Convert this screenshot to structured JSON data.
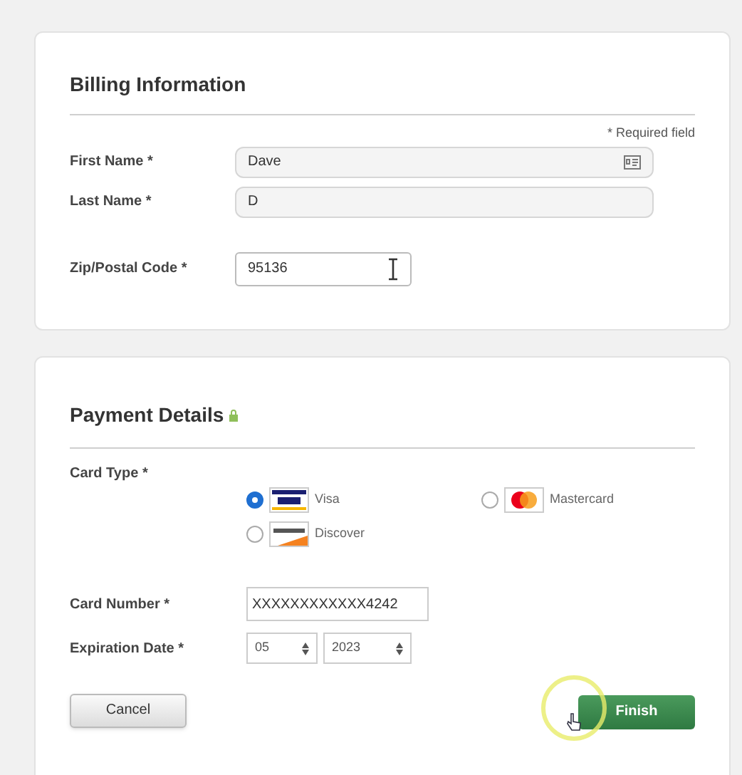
{
  "billing": {
    "title": "Billing Information",
    "required_note": "* Required field",
    "fields": [
      {
        "label": "First Name *",
        "value": "Dave",
        "kind": "wide",
        "contact_icon": true
      },
      {
        "label": "Last Name *",
        "value": "D",
        "kind": "wide",
        "contact_icon": false
      },
      {
        "label": "Zip/Postal Code *",
        "value": "95136",
        "kind": "short",
        "contact_icon": false
      }
    ]
  },
  "payment": {
    "title": "Payment Details",
    "card_type_label": "Card Type *",
    "card_types": [
      {
        "label": "Visa",
        "kind": "visa",
        "selected": true
      },
      {
        "label": "Mastercard",
        "kind": "mastercard",
        "selected": false
      },
      {
        "label": "Discover",
        "kind": "discover",
        "selected": false
      }
    ],
    "card_number": {
      "label": "Card Number *",
      "value": "XXXXXXXXXXXX4242"
    },
    "expiration": {
      "label": "Expiration Date *",
      "month": "05",
      "year": "2023"
    }
  },
  "buttons": [
    {
      "label": "Cancel",
      "kind": "secondary"
    },
    {
      "label": "Finish",
      "kind": "primary"
    }
  ]
}
